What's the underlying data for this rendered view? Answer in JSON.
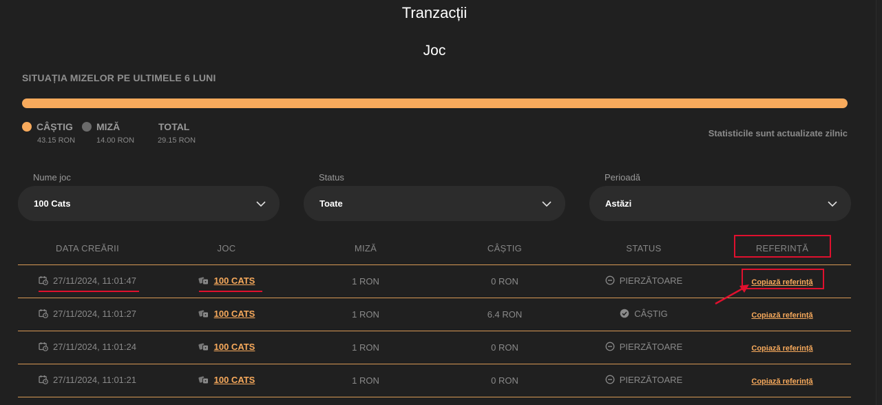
{
  "page": {
    "title": "Tranzacții",
    "section_title": "Joc"
  },
  "stats": {
    "heading": "SITUAȚIA MIZELOR PE ULTIMELE 6 LUNI",
    "win_fraction": 1.0,
    "legend": [
      {
        "label": "CÂȘTIG",
        "value": "43.15 RON",
        "color": "#f8aa5c"
      },
      {
        "label": "MIZĂ",
        "value": "14.00 RON",
        "color": "#6b6b6b"
      },
      {
        "label": "TOTAL",
        "value": "29.15 RON"
      }
    ],
    "update_note": "Statisticile sunt actualizate zilnic"
  },
  "filters": {
    "game": {
      "label": "Nume joc",
      "value": "100 Cats"
    },
    "status": {
      "label": "Status",
      "value": "Toate"
    },
    "period": {
      "label": "Perioadă",
      "value": "Astăzi"
    }
  },
  "table": {
    "headers": [
      "DATA CREĂRII",
      "JOC",
      "MIZĂ",
      "CÂȘTIG",
      "STATUS",
      "REFERINȚĂ"
    ],
    "rows": [
      {
        "date": "27/11/2024, 11:01:47",
        "game": "100 CATS",
        "bet": "1 RON",
        "win": "0 RON",
        "status": "PIERZĂTOARE",
        "status_icon": "minus-circle-icon",
        "ref": "Copiază referință"
      },
      {
        "date": "27/11/2024, 11:01:27",
        "game": "100 CATS",
        "bet": "1 RON",
        "win": "6.4 RON",
        "status": "CÂȘTIG",
        "status_icon": "check-circle-icon",
        "ref": "Copiază referință"
      },
      {
        "date": "27/11/2024, 11:01:24",
        "game": "100 CATS",
        "bet": "1 RON",
        "win": "0 RON",
        "status": "PIERZĂTOARE",
        "status_icon": "minus-circle-icon",
        "ref": "Copiază referință"
      },
      {
        "date": "27/11/2024, 11:01:21",
        "game": "100 CATS",
        "bet": "1 RON",
        "win": "0 RON",
        "status": "PIERZĂTOARE",
        "status_icon": "minus-circle-icon",
        "ref": "Copiază referință"
      }
    ]
  },
  "colors": {
    "accent": "#f8aa5c",
    "annotation": "#e0102e",
    "background": "#202020"
  }
}
